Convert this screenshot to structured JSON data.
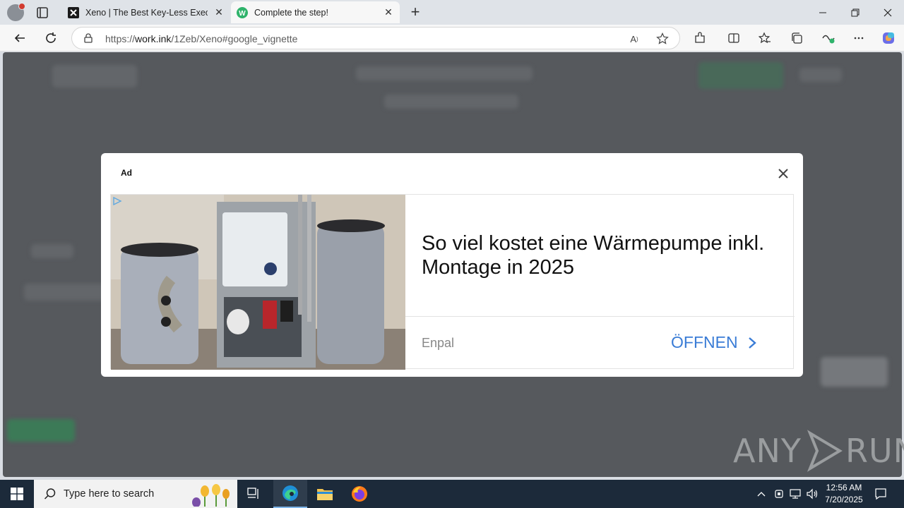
{
  "browser": {
    "tabs": [
      {
        "title": "Xeno | The Best Key-Less Executor",
        "favicon": "xeno-logo-icon",
        "active": false
      },
      {
        "title": "Complete the step!",
        "favicon": "workink-w-icon",
        "active": true
      }
    ],
    "new_tab_label": "+",
    "url": {
      "prefix": "https://",
      "host": "work.ink",
      "path": "/1Zeb/Xeno#google_vignette"
    }
  },
  "ad": {
    "label": "Ad",
    "headline": "So viel kostet eine Wärmepumpe inkl. Montage in 2025",
    "advertiser": "Enpal",
    "cta": "ÖFFNEN"
  },
  "watermark": {
    "text_left": "ANY",
    "text_right": "RUN"
  },
  "taskbar": {
    "search_placeholder": "Type here to search",
    "time": "12:56 AM",
    "date": "7/20/2025"
  },
  "colors": {
    "overlay": "#56595d",
    "cta_blue": "#3a7cd6",
    "taskbar": "#1c2a3a"
  }
}
